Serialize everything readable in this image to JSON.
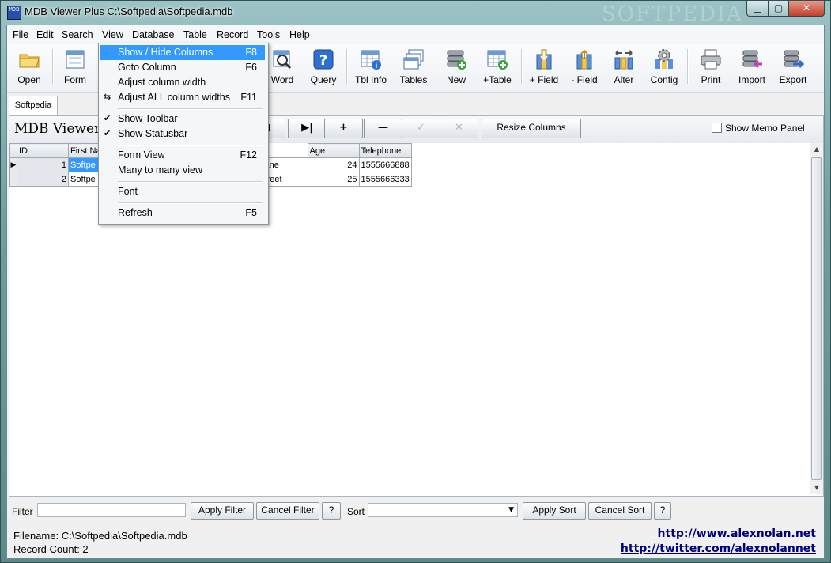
{
  "window": {
    "title": "MDB Viewer Plus C:\\Softpedia\\Softpedia.mdb",
    "watermark": "SOFTPEDIA",
    "app_icon_text": "MDB"
  },
  "menus": [
    "File",
    "Edit",
    "Search",
    "View",
    "Database",
    "Table",
    "Record",
    "Tools",
    "Help"
  ],
  "toolbar": [
    {
      "label": "Open",
      "icon": "folder-icon"
    },
    {
      "label": "Form",
      "icon": "form-icon"
    },
    {
      "label": "Word",
      "icon": "word-search-icon"
    },
    {
      "label": "Query",
      "icon": "query-icon"
    },
    {
      "label": "Tbl Info",
      "icon": "table-info-icon"
    },
    {
      "label": "Tables",
      "icon": "tables-icon"
    },
    {
      "label": "New",
      "icon": "new-db-icon"
    },
    {
      "label": "+Table",
      "icon": "add-table-icon"
    },
    {
      "label": "+ Field",
      "icon": "add-field-icon"
    },
    {
      "label": "- Field",
      "icon": "remove-field-icon"
    },
    {
      "label": "Alter",
      "icon": "alter-icon"
    },
    {
      "label": "Config",
      "icon": "config-gear-icon"
    },
    {
      "label": "Print",
      "icon": "printer-icon"
    },
    {
      "label": "Import",
      "icon": "import-icon"
    },
    {
      "label": "Export",
      "icon": "export-icon"
    }
  ],
  "tab": "Softpedia",
  "panel": {
    "title": "MDB Viewer",
    "resize_label": "Resize Columns",
    "memo_label": "Show Memo Panel"
  },
  "nav_buttons": [
    {
      "label": "◀",
      "enabled": true
    },
    {
      "label": "▶|",
      "enabled": true
    },
    {
      "label": "+",
      "enabled": true
    },
    {
      "label": "—",
      "enabled": true
    },
    {
      "label": "✓",
      "enabled": false
    },
    {
      "label": "✕",
      "enabled": false
    }
  ],
  "grid": {
    "headers": [
      "ID",
      "First Na",
      "",
      "Age",
      "Telephone"
    ],
    "rows": [
      {
        "indicator": "▶",
        "id": "1",
        "first": "Softpe",
        "street": "ane",
        "age": "24",
        "tel": "1555666888"
      },
      {
        "indicator": "",
        "id": "2",
        "first": "Softpe",
        "street": "treet",
        "age": "25",
        "tel": "1555666333"
      }
    ]
  },
  "filter": {
    "filter_label": "Filter",
    "apply_filter": "Apply Filter",
    "cancel_filter": "Cancel Filter",
    "help": "?",
    "sort_label": "Sort",
    "apply_sort": "Apply Sort",
    "cancel_sort": "Cancel Sort"
  },
  "status": {
    "filename": "Filename: C:\\Softpedia\\Softpedia.mdb",
    "records": "Record Count: 2",
    "link1": "http://www.alexnolan.net",
    "link2": "http://twitter.com/alexnolannet"
  },
  "view_menu": [
    {
      "label": "Show / Hide Columns",
      "key": "F8",
      "highlight": true,
      "mark": ""
    },
    {
      "label": "Goto Column",
      "key": "F6",
      "mark": ""
    },
    {
      "label": "Adjust column width",
      "key": "",
      "mark": ""
    },
    {
      "label": "Adjust ALL column widths",
      "key": "F11",
      "mark": "⇆"
    },
    {
      "label": "Show Toolbar",
      "key": "",
      "mark": "✔"
    },
    {
      "label": "Show Statusbar",
      "key": "",
      "mark": "✔"
    },
    {
      "label": "Form View",
      "key": "F12",
      "mark": ""
    },
    {
      "label": "Many to many view",
      "key": "",
      "mark": ""
    },
    {
      "label": "Font",
      "key": "",
      "mark": ""
    },
    {
      "label": "Refresh",
      "key": "F5",
      "mark": ""
    }
  ]
}
